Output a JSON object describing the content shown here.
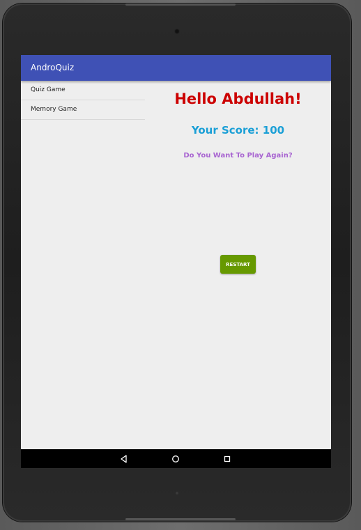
{
  "app": {
    "title": "AndroQuiz"
  },
  "menu": {
    "items": [
      {
        "label": "Quiz Game"
      },
      {
        "label": "Memory Game"
      }
    ]
  },
  "result": {
    "greeting": "Hello Abdullah!",
    "score": "Your Score: 100",
    "prompt": "Do You Want To Play Again?",
    "restart_label": "RESTART"
  },
  "navbar": {
    "icons": [
      "back-icon",
      "home-icon",
      "recents-icon"
    ]
  },
  "colors": {
    "appbar": "#3f51b5",
    "greeting": "#cc0000",
    "score": "#1a9fd6",
    "prompt": "#a864d1",
    "restart_button": "#669900"
  }
}
